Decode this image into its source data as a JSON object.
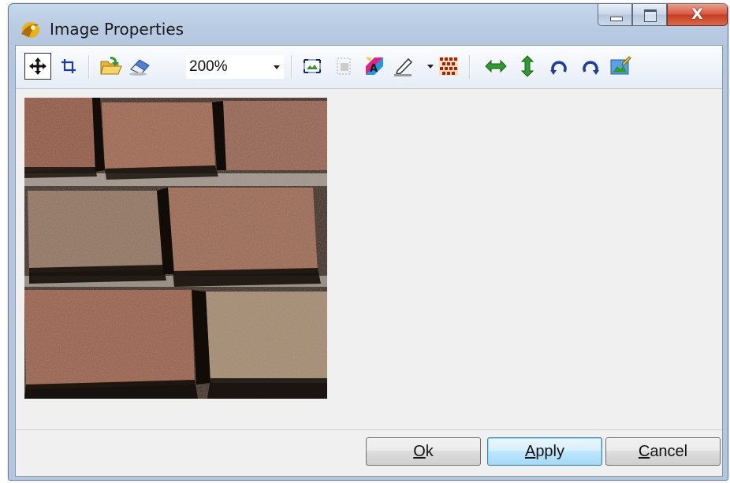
{
  "window": {
    "title": "Image Properties",
    "close_glyph": "X"
  },
  "toolbar": {
    "tools": [
      {
        "icon": "move-icon",
        "active": true
      },
      {
        "icon": "crop-icon",
        "active": false
      },
      {
        "icon": "open-folder-icon",
        "active": false
      },
      {
        "icon": "eraser-icon",
        "active": false
      },
      {
        "icon": "fit-image-icon",
        "active": false
      },
      {
        "icon": "select-area-icon",
        "active": false
      },
      {
        "icon": "color-adjust-icon",
        "active": false
      },
      {
        "icon": "pen-icon",
        "active": false
      },
      {
        "icon": "grid-pattern-icon",
        "active": false
      },
      {
        "icon": "flip-horizontal-icon",
        "active": false
      },
      {
        "icon": "flip-vertical-icon",
        "active": false
      },
      {
        "icon": "rotate-left-icon",
        "active": false
      },
      {
        "icon": "rotate-right-icon",
        "active": false
      },
      {
        "icon": "edit-image-icon",
        "active": false
      }
    ],
    "zoom": {
      "value": "200%"
    }
  },
  "preview": {
    "image": "brick-wall-texture"
  },
  "buttons": {
    "ok": {
      "mnemonic": "O",
      "rest": "k"
    },
    "apply": {
      "mnemonic": "A",
      "rest": "pply"
    },
    "cancel": {
      "mnemonic": "C",
      "rest": "ancel"
    }
  },
  "colors": {
    "title_bar": "#b8cbe2",
    "close_button": "#c73b20",
    "client_bg": "#f0f0f0",
    "default_button_border": "#3c7fb1"
  }
}
